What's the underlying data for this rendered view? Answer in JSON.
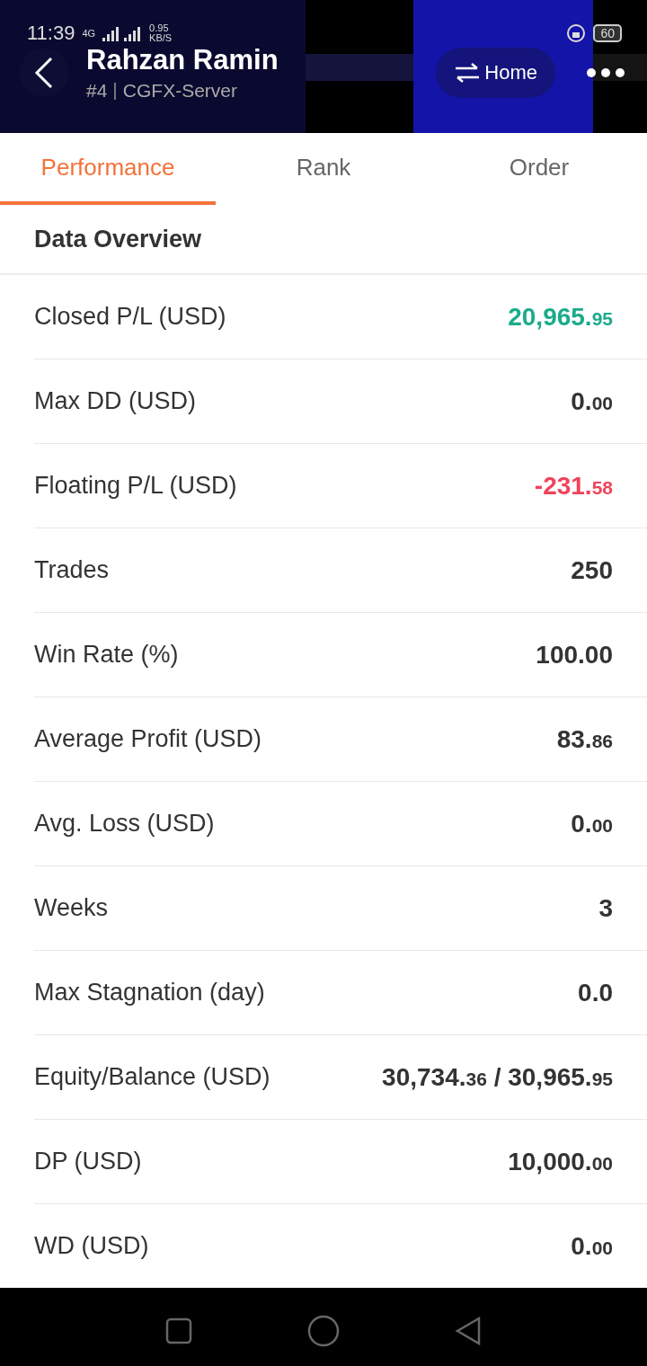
{
  "status_bar": {
    "time": "11:39",
    "network": "4G",
    "speed": "0.95",
    "speed_unit": "KB/S",
    "battery": "60"
  },
  "header": {
    "kind": "picture",
    "title": "Rahzan Ramin",
    "rank": "#4",
    "separator": "|",
    "server": "CGFX-Server",
    "home_label": "Home"
  },
  "tabs": [
    {
      "label": "Performance",
      "selected": true
    },
    {
      "label": "Rank",
      "selected": false
    },
    {
      "label": "Order",
      "selected": false
    }
  ],
  "section_title": "Data Overview",
  "rows": [
    {
      "label": "Closed P/L (USD)",
      "color": "#1aab8a",
      "value": [
        {
          "main": "20,965.",
          "cents": "95"
        }
      ]
    },
    {
      "label": "Max DD (USD)",
      "color": "#333333",
      "value": [
        {
          "main": "0.",
          "cents": "00"
        }
      ]
    },
    {
      "label": "Floating P/L (USD)",
      "color": "#f0435a",
      "value": [
        {
          "main": "-231.",
          "cents": "58"
        }
      ]
    },
    {
      "label": "Trades",
      "color": "#333333",
      "value": [
        {
          "main": "250"
        }
      ]
    },
    {
      "label": "Win Rate (%)",
      "color": "#333333",
      "value": [
        {
          "main": "100.00"
        }
      ]
    },
    {
      "label": "Average Profit (USD)",
      "color": "#333333",
      "value": [
        {
          "main": "83.",
          "cents": "86"
        }
      ]
    },
    {
      "label": "Avg. Loss (USD)",
      "color": "#333333",
      "value": [
        {
          "main": "0.",
          "cents": "00"
        }
      ]
    },
    {
      "label": "Weeks",
      "color": "#333333",
      "value": [
        {
          "main": "3"
        }
      ]
    },
    {
      "label": "Max Stagnation (day)",
      "color": "#333333",
      "value": [
        {
          "main": "0.0"
        }
      ]
    },
    {
      "label": "Equity/Balance (USD)",
      "color": "#333333",
      "value": [
        {
          "main": "30,734.",
          "cents": "36"
        },
        {
          "main": " / 30,965.",
          "cents": "95"
        }
      ]
    },
    {
      "label": "DP (USD)",
      "color": "#333333",
      "value": [
        {
          "main": "10,000.",
          "cents": "00"
        }
      ]
    },
    {
      "label": "WD (USD)",
      "color": "#333333",
      "value": [
        {
          "main": "0.",
          "cents": "00"
        }
      ]
    }
  ]
}
